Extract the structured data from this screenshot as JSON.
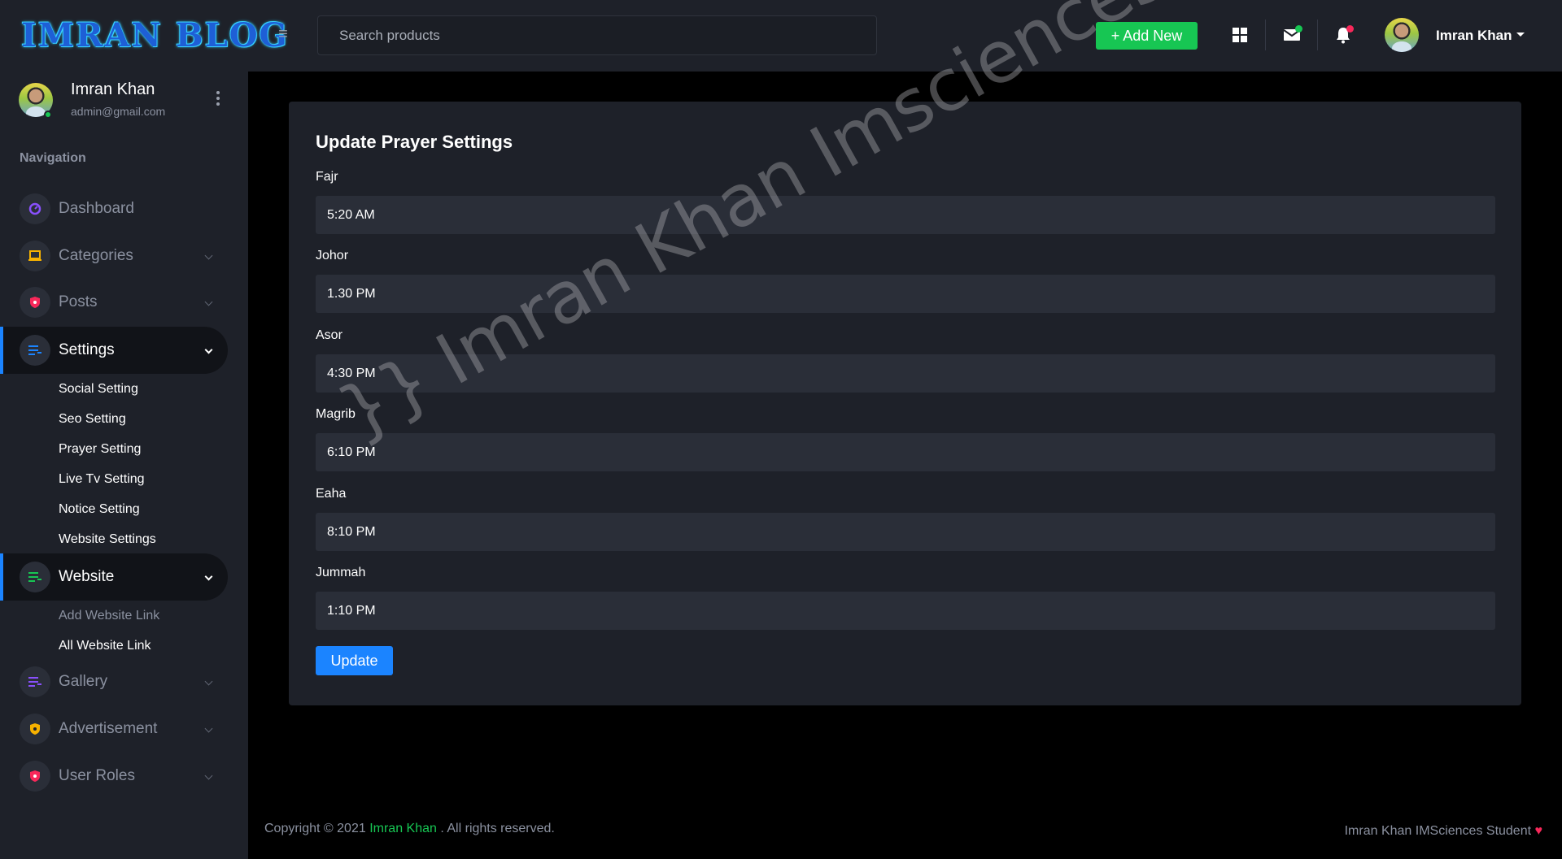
{
  "header": {
    "logo": "IMRAN BLOG",
    "search_placeholder": "Search products",
    "add_new_label": "+ Add New",
    "user_name": "Imran Khan"
  },
  "sidebar": {
    "user_name": "Imran Khan",
    "user_email": "admin@gmail.com",
    "nav_title": "Navigation",
    "items": [
      {
        "label": "Dashboard",
        "icon": "gauge-icon"
      },
      {
        "label": "Categories",
        "icon": "laptop-icon"
      },
      {
        "label": "Posts",
        "icon": "shield-icon"
      },
      {
        "label": "Settings",
        "icon": "list-icon",
        "active": true,
        "subitems": [
          "Social Setting",
          "Seo Setting",
          "Prayer Setting",
          "Live Tv Setting",
          "Notice Setting",
          "Website Settings"
        ]
      },
      {
        "label": "Website",
        "icon": "list-icon",
        "active": true,
        "subitems": [
          "Add Website Link",
          "All Website Link"
        ]
      },
      {
        "label": "Gallery",
        "icon": "list-icon"
      },
      {
        "label": "Advertisement",
        "icon": "shield-icon"
      },
      {
        "label": "User Roles",
        "icon": "shield-icon"
      }
    ]
  },
  "form": {
    "title": "Update Prayer Settings",
    "fields": [
      {
        "label": "Fajr",
        "value": "5:20 AM"
      },
      {
        "label": "Johor",
        "value": "1.30 PM"
      },
      {
        "label": "Asor",
        "value": "4:30 PM"
      },
      {
        "label": "Magrib",
        "value": "6:10 PM"
      },
      {
        "label": "Eaha",
        "value": "8:10 PM"
      },
      {
        "label": "Jummah",
        "value": "1:10 PM"
      }
    ],
    "submit_label": "Update"
  },
  "watermark": "}} Imran Khan Imsciences }}",
  "footer": {
    "copyright_prefix": "Copyright © 2021",
    "copyright_brand": "Imran Khan",
    "copyright_suffix": ". All rights reserved.",
    "credit": "Imran Khan IMSciences Student",
    "heart": "♥"
  },
  "colors": {
    "accent_blue": "#1b84ff",
    "accent_green": "#17c653",
    "danger_red": "#f8285a",
    "panel": "#1e2129",
    "input": "#2a2e38"
  }
}
